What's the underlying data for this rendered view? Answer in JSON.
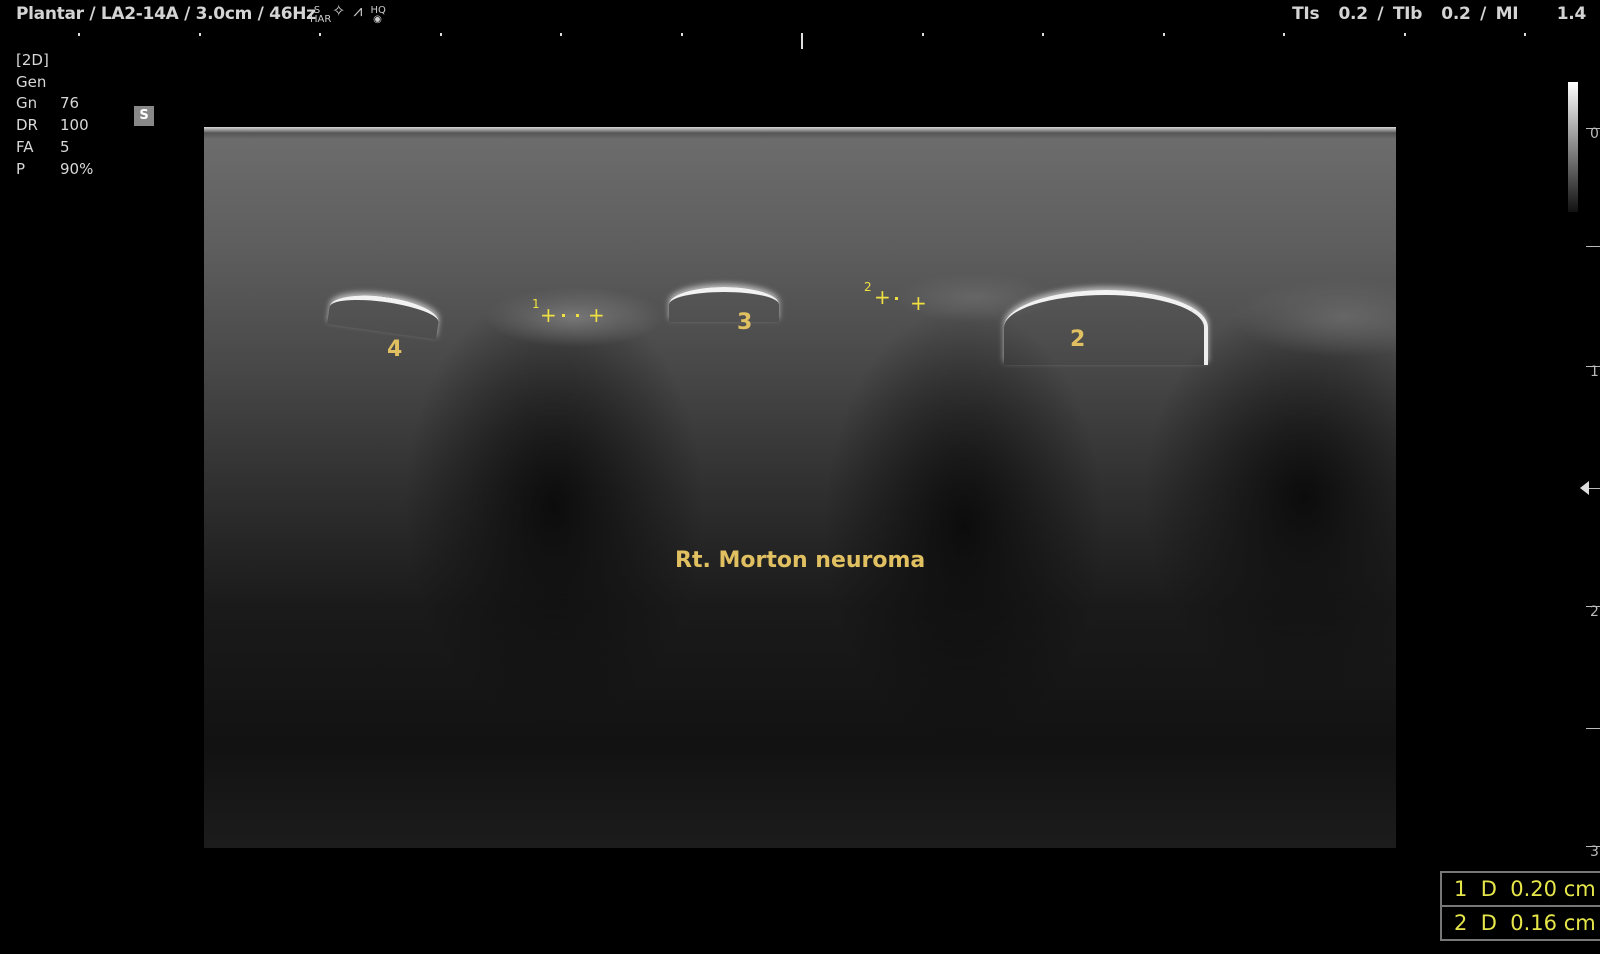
{
  "header": {
    "left": "Plantar / LA2-14A / 3.0cm / 46Hz",
    "right": "TIs  0.2 / TIb  0.2 / MI    1.4",
    "icons": [
      {
        "name": "s-har-icon",
        "text": "S HAR"
      },
      {
        "name": "crystal-icon",
        "text": "✧"
      },
      {
        "name": "beam-icon",
        "text": "⩘"
      },
      {
        "name": "hq-icon",
        "text": "HQ ◉"
      }
    ]
  },
  "params": {
    "mode": "[2D]",
    "preset": "Gen",
    "rows": [
      {
        "k": "Gn",
        "v": "76"
      },
      {
        "k": "DR",
        "v": "100"
      },
      {
        "k": "FA",
        "v": "5"
      },
      {
        "k": "P",
        "v": "90%"
      }
    ],
    "s_badge": "S"
  },
  "image": {
    "labels": [
      "4",
      "3",
      "2"
    ],
    "caption": "Rt. Morton neuroma",
    "caliper_labels": [
      "1",
      "2"
    ]
  },
  "depth_scale": [
    "0",
    "1",
    "2",
    "3"
  ],
  "measurements": [
    {
      "id": "1",
      "type": "D",
      "value": "0.20 cm"
    },
    {
      "id": "2",
      "type": "D",
      "value": "0.16 cm"
    }
  ]
}
